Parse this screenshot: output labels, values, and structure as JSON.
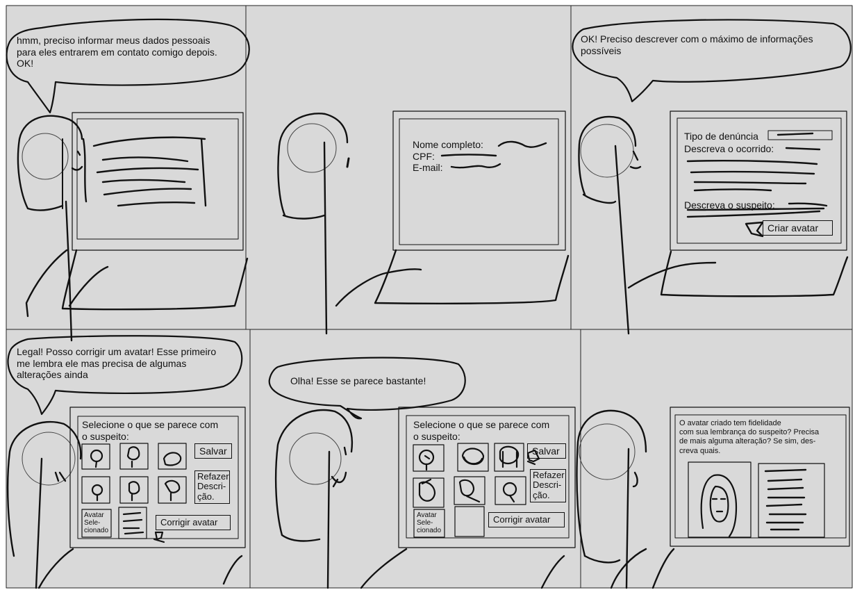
{
  "panels": {
    "p1": {
      "speech": [
        "hmm, preciso informar meus dados pessoais",
        "para eles entrarem em contato comigo depois.",
        "OK!"
      ]
    },
    "p2": {
      "form": {
        "name_label": "Nome completo:",
        "cpf_label": "CPF:",
        "email_label": "E-mail:"
      }
    },
    "p3": {
      "speech": [
        "OK! Preciso descrever com o máximo de informações",
        "possíveis"
      ],
      "form": {
        "type_label": "Tipo de denúncia",
        "occurrence_label": "Descreva o ocorrido:",
        "suspect_label": "Descreva o suspeito:",
        "create_avatar_button": "Criar avatar"
      }
    },
    "p4": {
      "speech": [
        "Legal! Posso corrigir um avatar! Esse primeiro",
        "me lembra ele mas precisa de algumas",
        "alterações ainda"
      ],
      "screen": {
        "title_lines": [
          "Selecione o que se parece com",
          "o suspeito:"
        ],
        "save_button": "Salvar",
        "redo_button_lines": [
          "Refazer",
          "Descri-",
          "ção."
        ],
        "selected_label_lines": [
          "Avatar",
          "Sele-",
          "cionado"
        ],
        "fix_button": "Corrigir avatar"
      }
    },
    "p5": {
      "speech": [
        "Olha! Esse se parece bastante!"
      ],
      "screen": {
        "title_lines": [
          "Selecione o que se parece com",
          "o suspeito:"
        ],
        "save_button": "Salvar",
        "redo_button_lines": [
          "Refazer",
          "Descri-",
          "ção."
        ],
        "selected_label_lines": [
          "Avatar",
          "Sele-",
          "cionado"
        ],
        "fix_button": "Corrigir avatar"
      }
    },
    "p6": {
      "screen": {
        "message_lines": [
          "O avatar criado tem fidelidade",
          "com sua lembrança do suspeito? Precisa",
          "de mais alguma alteração? Se sim, des-",
          "creva quais."
        ]
      }
    }
  },
  "colors": {
    "panel_bg": "#d9d9d9",
    "ink": "#111111",
    "page_bg": "#ffffff"
  }
}
